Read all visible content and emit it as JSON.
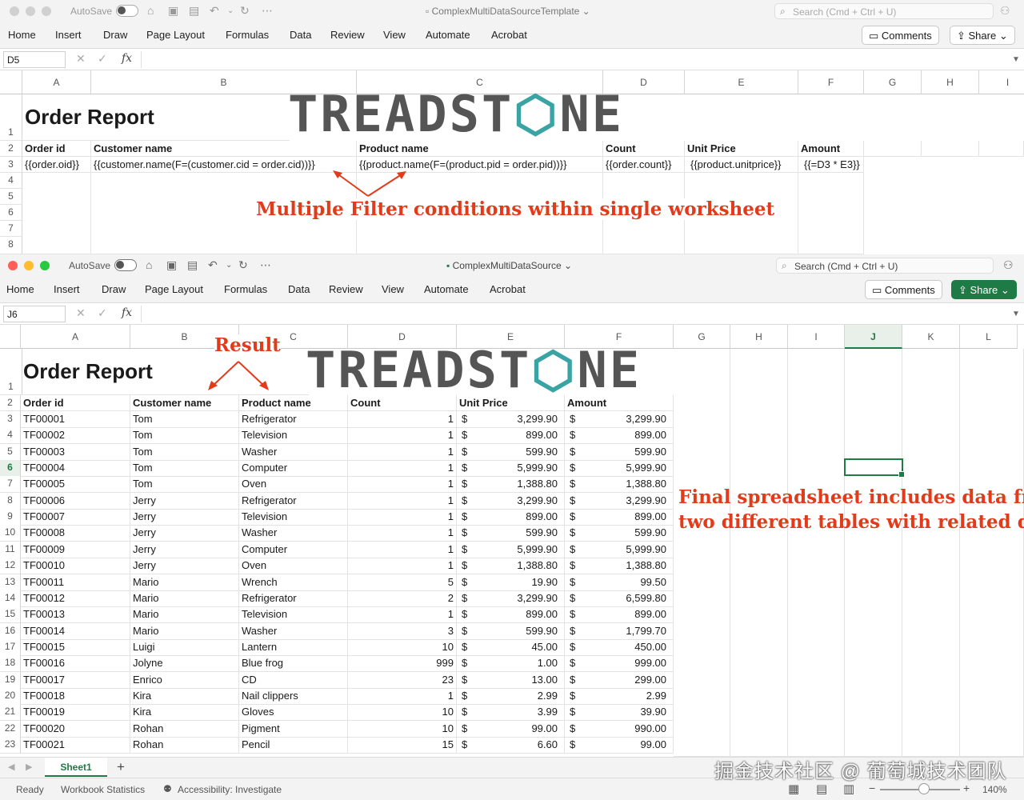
{
  "top": {
    "autosave_label": "AutoSave",
    "doc_title": "ComplexMultiDataSourceTemplate",
    "search_placeholder": "Search (Cmd + Ctrl + U)",
    "tabs": [
      "Home",
      "Insert",
      "Draw",
      "Page Layout",
      "Formulas",
      "Data",
      "Review",
      "View",
      "Automate",
      "Acrobat"
    ],
    "comments_label": "Comments",
    "share_label": "Share",
    "name_box": "D5",
    "fx_label": "fx",
    "columns": [
      "A",
      "B",
      "C",
      "D",
      "E",
      "F",
      "G",
      "H",
      "I"
    ],
    "rows": [
      "1",
      "2",
      "3",
      "4",
      "5",
      "6",
      "7",
      "8"
    ],
    "sheet_title": "Order Report",
    "headers": [
      "Order id",
      "Customer name",
      "Product name",
      "Count",
      "Unit Price",
      "Amount"
    ],
    "template_row": [
      "{{order.oid}}",
      "{{customer.name(F=(customer.cid = order.cid))}}",
      "{{product.name(F=(product.pid = order.pid))}}",
      "{{order.count}}",
      "{{product.unitprice}}",
      "{{=D3 * E3}}"
    ],
    "annotation": "Multiple Filter conditions within single worksheet"
  },
  "bottom": {
    "autosave_label": "AutoSave",
    "doc_title": "ComplexMultiDataSource",
    "search_placeholder": "Search (Cmd + Ctrl + U)",
    "tabs": [
      "Home",
      "Insert",
      "Draw",
      "Page Layout",
      "Formulas",
      "Data",
      "Review",
      "View",
      "Automate",
      "Acrobat"
    ],
    "comments_label": "Comments",
    "share_label": "Share",
    "name_box": "J6",
    "fx_label": "fx",
    "columns": [
      "A",
      "B",
      "C",
      "D",
      "E",
      "F",
      "G",
      "H",
      "I",
      "J",
      "K",
      "L"
    ],
    "sheet_title": "Order Report",
    "headers": [
      "Order id",
      "Customer name",
      "Product name",
      "Count",
      "Unit Price",
      "Amount"
    ],
    "result_label": "Result",
    "annotation_lines": [
      "Final spreadsheet includes data from",
      "two different tables with related data"
    ],
    "currency": "$",
    "orders": [
      {
        "id": "TF00001",
        "customer": "Tom",
        "product": "Refrigerator",
        "count": "1",
        "price": "3,299.90",
        "amount": "3,299.90"
      },
      {
        "id": "TF00002",
        "customer": "Tom",
        "product": "Television",
        "count": "1",
        "price": "899.00",
        "amount": "899.00"
      },
      {
        "id": "TF00003",
        "customer": "Tom",
        "product": "Washer",
        "count": "1",
        "price": "599.90",
        "amount": "599.90"
      },
      {
        "id": "TF00004",
        "customer": "Tom",
        "product": "Computer",
        "count": "1",
        "price": "5,999.90",
        "amount": "5,999.90"
      },
      {
        "id": "TF00005",
        "customer": "Tom",
        "product": "Oven",
        "count": "1",
        "price": "1,388.80",
        "amount": "1,388.80"
      },
      {
        "id": "TF00006",
        "customer": "Jerry",
        "product": "Refrigerator",
        "count": "1",
        "price": "3,299.90",
        "amount": "3,299.90"
      },
      {
        "id": "TF00007",
        "customer": "Jerry",
        "product": "Television",
        "count": "1",
        "price": "899.00",
        "amount": "899.00"
      },
      {
        "id": "TF00008",
        "customer": "Jerry",
        "product": "Washer",
        "count": "1",
        "price": "599.90",
        "amount": "599.90"
      },
      {
        "id": "TF00009",
        "customer": "Jerry",
        "product": "Computer",
        "count": "1",
        "price": "5,999.90",
        "amount": "5,999.90"
      },
      {
        "id": "TF00010",
        "customer": "Jerry",
        "product": "Oven",
        "count": "1",
        "price": "1,388.80",
        "amount": "1,388.80"
      },
      {
        "id": "TF00011",
        "customer": "Mario",
        "product": "Wrench",
        "count": "5",
        "price": "19.90",
        "amount": "99.50"
      },
      {
        "id": "TF00012",
        "customer": "Mario",
        "product": "Refrigerator",
        "count": "2",
        "price": "3,299.90",
        "amount": "6,599.80"
      },
      {
        "id": "TF00013",
        "customer": "Mario",
        "product": "Television",
        "count": "1",
        "price": "899.00",
        "amount": "899.00"
      },
      {
        "id": "TF00014",
        "customer": "Mario",
        "product": "Washer",
        "count": "3",
        "price": "599.90",
        "amount": "1,799.70"
      },
      {
        "id": "TF00015",
        "customer": "Luigi",
        "product": "Lantern",
        "count": "10",
        "price": "45.00",
        "amount": "450.00"
      },
      {
        "id": "TF00016",
        "customer": "Jolyne",
        "product": "Blue frog",
        "count": "999",
        "price": "1.00",
        "amount": "999.00"
      },
      {
        "id": "TF00017",
        "customer": "Enrico",
        "product": "CD",
        "count": "23",
        "price": "13.00",
        "amount": "299.00"
      },
      {
        "id": "TF00018",
        "customer": "Kira",
        "product": "Nail clippers",
        "count": "1",
        "price": "2.99",
        "amount": "2.99"
      },
      {
        "id": "TF00019",
        "customer": "Kira",
        "product": "Gloves",
        "count": "10",
        "price": "3.99",
        "amount": "39.90"
      },
      {
        "id": "TF00020",
        "customer": "Rohan",
        "product": "Pigment",
        "count": "10",
        "price": "99.00",
        "amount": "990.00"
      },
      {
        "id": "TF00021",
        "customer": "Rohan",
        "product": "Pencil",
        "count": "15",
        "price": "6.60",
        "amount": "99.00"
      }
    ],
    "sheet_tab": "Sheet1",
    "add_sheet": "+",
    "status_ready": "Ready",
    "status_workbook": "Workbook Statistics",
    "status_accessibility": "Accessibility: Investigate",
    "zoom": "140%"
  },
  "logo_text": [
    "TREADST",
    "NE"
  ],
  "watermark": "掘金技术社区 @ 葡萄城技术团队",
  "colors": {
    "accent_green": "#1e7b45",
    "annotation_red": "#e23b1b",
    "logo_gray": "#555555",
    "logo_teal": "#3aa3a3"
  }
}
